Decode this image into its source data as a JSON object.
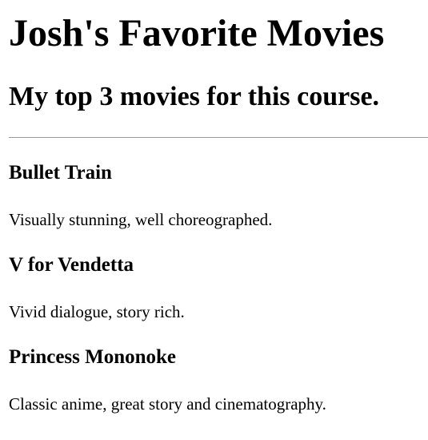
{
  "page": {
    "title": "Josh's Favorite Movies",
    "subtitle": "My top 3 movies for this course."
  },
  "movies": [
    {
      "title": "Bullet Train",
      "description": "Visually stunning, well choreographed."
    },
    {
      "title": "V for Vendetta",
      "description": "Vivid dialogue, story rich."
    },
    {
      "title": "Princess Mononoke",
      "description": "Classic anime, great story and cinematography."
    }
  ]
}
